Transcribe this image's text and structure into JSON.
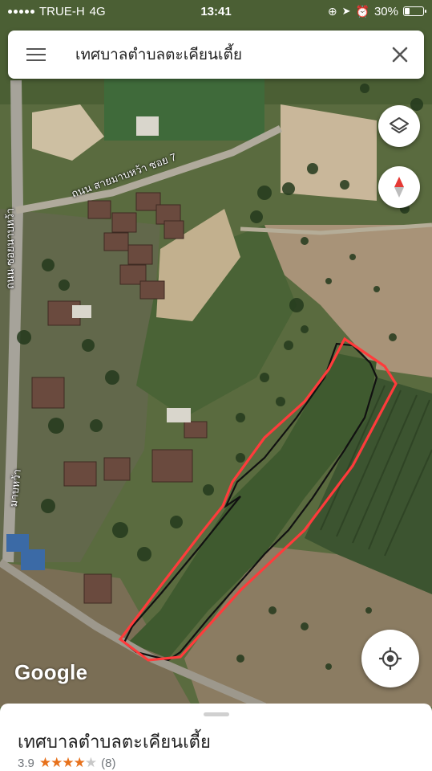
{
  "status_bar": {
    "carrier": "TRUE-H",
    "network": "4G",
    "time": "13:41",
    "battery": "30%",
    "battery_level": 0.3
  },
  "search": {
    "query": "เทศบาลตำบลตะเคียนเตี้ย"
  },
  "map": {
    "road_label_1": "ถนน สายมาบหว้า ซอย 7",
    "road_label_2": "ถนน ซอยนาบหว้า",
    "road_label_3": "มาบหว้า",
    "attribution": "Google",
    "overlay_color": "#ff3b3b"
  },
  "place": {
    "name": "เทศบาลตำบลตะเคียนเตี้ย",
    "rating": "3.9",
    "rating_value": 3.9,
    "review_count": "(8)"
  },
  "icons": {
    "menu": "hamburger-menu-icon",
    "close": "close-icon",
    "layers": "layers-icon",
    "compass": "compass-icon",
    "location": "my-location-icon"
  }
}
